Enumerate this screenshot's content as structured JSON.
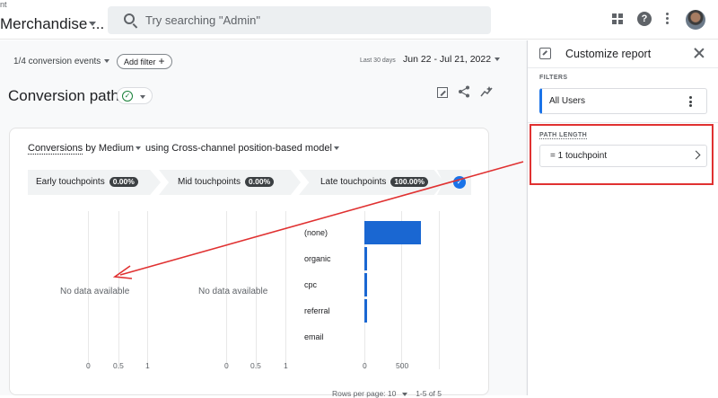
{
  "topbar": {
    "property_small": "nt",
    "property_name": "Merchandise ...",
    "search_placeholder": "Try searching \"Admin\""
  },
  "toolbar": {
    "conversion_events": "1/4 conversion events",
    "add_filter": "Add filter",
    "date_small": "Last 30 days",
    "date_range": "Jun 22 - Jul 21, 2022"
  },
  "page": {
    "title": "Conversion paths"
  },
  "card": {
    "dimension_prefix": "Conversions",
    "dimension_by": " by Medium",
    "model_text": "using Cross-channel position-based model",
    "touchpoints": [
      {
        "label": "Early touchpoints",
        "value": "0.00%"
      },
      {
        "label": "Mid touchpoints",
        "value": "0.00%"
      },
      {
        "label": "Late touchpoints",
        "value": "100.00%"
      }
    ],
    "no_data_early": "No data available",
    "no_data_mid": "No data available",
    "ticks_early": [
      "0",
      "0.5",
      "1"
    ],
    "ticks_mid": [
      "0",
      "0.5",
      "1"
    ],
    "pager_text": "Rows per page: 10",
    "pager_range": "1-5 of 5"
  },
  "chart_data": {
    "type": "bar",
    "orientation": "horizontal",
    "categories": [
      "(none)",
      "organic",
      "cpc",
      "referral",
      "email"
    ],
    "values": [
      780,
      30,
      15,
      12,
      0
    ],
    "xlim": [
      0,
      1000
    ],
    "x_ticks": [
      "0",
      "500"
    ],
    "color": "#1a67d2"
  },
  "panel": {
    "title": "Customize report",
    "filters_label": "FILTERS",
    "filter_value": "All Users",
    "path_label": "PATH LENGTH",
    "path_value": "= 1 touchpoint"
  },
  "annotation_color": "#e03131"
}
